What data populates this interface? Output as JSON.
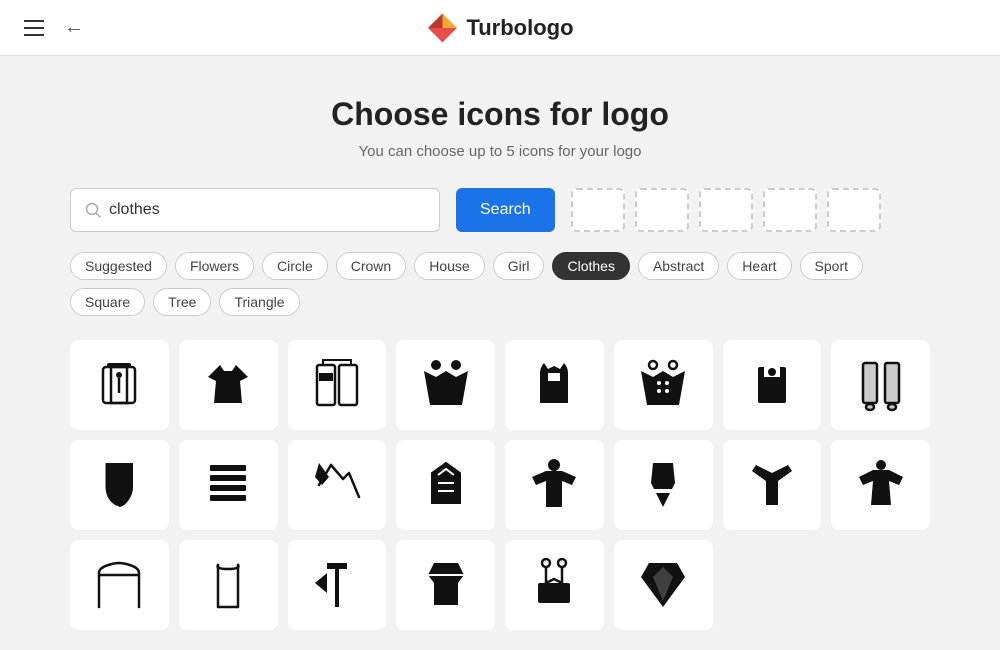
{
  "header": {
    "logo_text": "Turbologo",
    "back_label": "←"
  },
  "page": {
    "title": "Choose icons for logo",
    "subtitle": "You can choose up to 5 icons for your logo"
  },
  "search": {
    "placeholder": "clothes",
    "value": "clothes",
    "button_label": "Search"
  },
  "tags": [
    {
      "label": "Suggested",
      "active": false
    },
    {
      "label": "Flowers",
      "active": false
    },
    {
      "label": "Circle",
      "active": false
    },
    {
      "label": "Crown",
      "active": false
    },
    {
      "label": "House",
      "active": false
    },
    {
      "label": "Girl",
      "active": false
    },
    {
      "label": "Clothes",
      "active": true
    },
    {
      "label": "Abstract",
      "active": false
    },
    {
      "label": "Heart",
      "active": false
    },
    {
      "label": "Sport",
      "active": false
    },
    {
      "label": "Square",
      "active": false
    },
    {
      "label": "Tree",
      "active": false
    },
    {
      "label": "Triangle",
      "active": false
    }
  ],
  "slots_count": 5
}
